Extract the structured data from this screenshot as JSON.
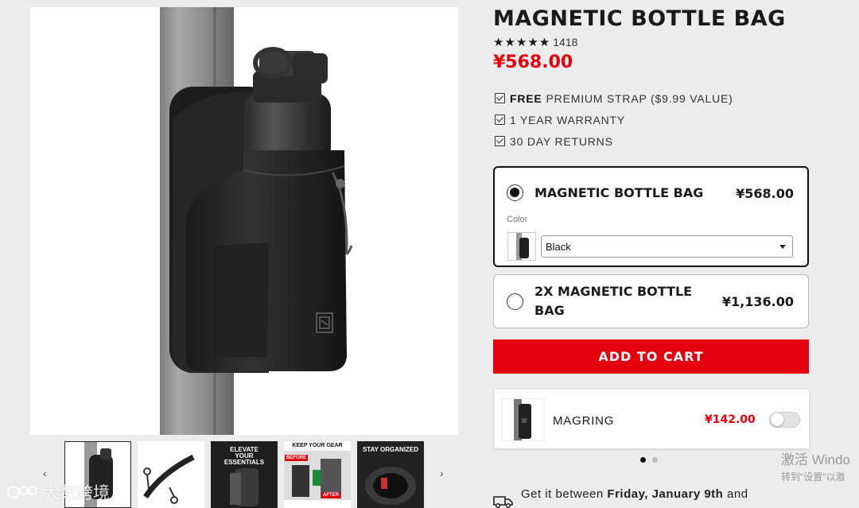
{
  "colors": {
    "accent": "#e3000f",
    "text": "#1a1a1a",
    "background": "#ececec"
  },
  "gallery": {
    "main_image_alt": "",
    "prev_arrow": "‹",
    "next_arrow": "›",
    "thumbnails": [
      {
        "caption": ""
      },
      {
        "caption": ""
      },
      {
        "caption": "ELEVATE YOUR ESSENTIALS"
      },
      {
        "caption": "KEEP YOUR GEAR",
        "badge_before": "BEFORE",
        "badge_after": "AFTER"
      },
      {
        "caption": "STAY ORGANIZED"
      }
    ]
  },
  "product": {
    "title": "MAGNETIC BOTTLE BAG",
    "stars": "★★★★★",
    "review_count": "1418",
    "price": "¥568.00",
    "perks": [
      {
        "bold": "FREE",
        "text": "PREMIUM STRAP ($9.99 VALUE)"
      },
      {
        "bold": "",
        "text": "1 YEAR WARRANTY"
      },
      {
        "bold": "",
        "text": "30 DAY RETURNS"
      }
    ],
    "options": [
      {
        "name": "MAGNETIC BOTTLE BAG",
        "price": "¥568.00",
        "selected": true,
        "color_label": "Color",
        "color_value": "Black"
      },
      {
        "name_line1": "2X MAGNETIC BOTTLE",
        "name_line2": "BAG",
        "price": "¥1,136.00",
        "selected": false
      }
    ],
    "add_to_cart": "ADD TO CART",
    "upsell": {
      "name": "MAGRING",
      "price": "¥142.00",
      "enabled": false
    },
    "carousel": {
      "active_index": 0,
      "count": 2
    },
    "delivery": {
      "prefix": "Get it between",
      "date": "Friday, January 9th",
      "suffix": "and"
    }
  },
  "overlays": {
    "watermark": "大数跨境",
    "windows_activation_line1": "激活 Windo",
    "windows_activation_line2": "转到\"设置\"以激"
  }
}
